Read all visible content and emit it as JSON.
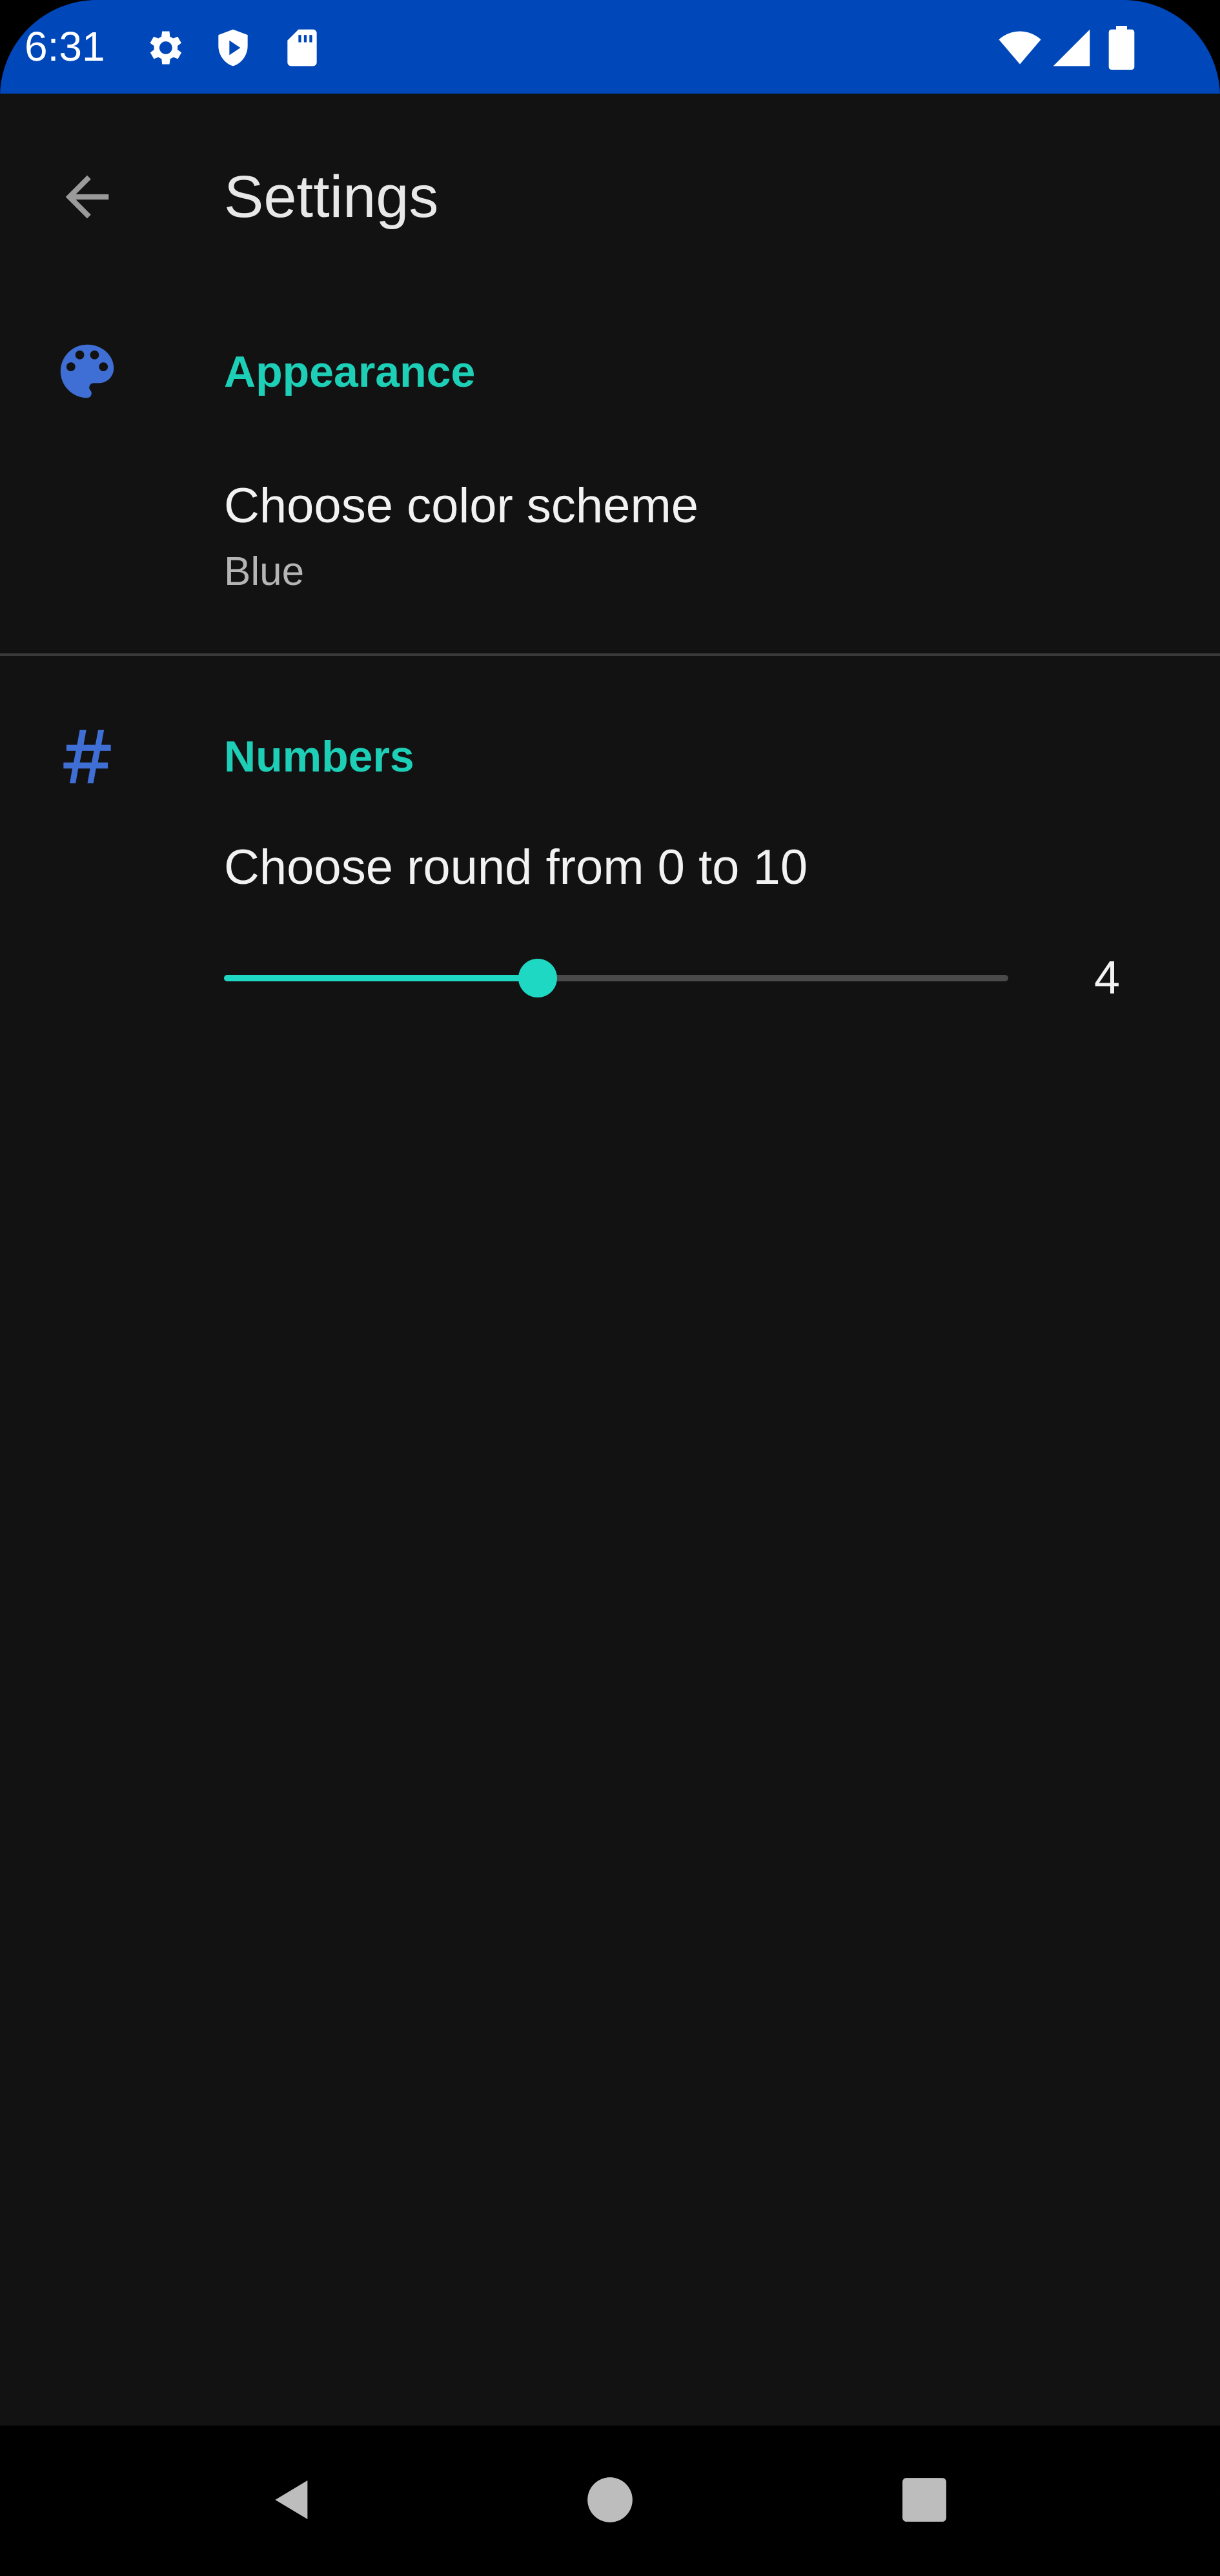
{
  "status_bar": {
    "time": "6:31",
    "icons": [
      "gear-icon",
      "shield-play-icon",
      "sd-card-icon",
      "wifi-icon",
      "cell-signal-icon",
      "battery-icon"
    ]
  },
  "toolbar": {
    "title": "Settings",
    "back_icon": "arrow-back-icon"
  },
  "sections": {
    "appearance": {
      "icon": "palette-icon",
      "title": "Appearance",
      "items": [
        {
          "title": "Choose color scheme",
          "summary": "Blue"
        }
      ]
    },
    "numbers": {
      "icon": "hash-icon",
      "title": "Numbers",
      "items": [
        {
          "title": "Choose round from 0 to 10",
          "slider": {
            "min": 0,
            "max": 10,
            "value": 4
          },
          "value_label": "4"
        }
      ]
    }
  },
  "nav_bar": {
    "buttons": [
      "back-triangle-icon",
      "home-circle-icon",
      "recents-square-icon"
    ]
  },
  "colors": {
    "status_bar": "#0047b9",
    "background": "#121212",
    "accent": "#1ecfb8",
    "icon_blue": "#3f6fd4",
    "text_primary": "#f2f2f2",
    "text_secondary": "#b5b5b5"
  }
}
